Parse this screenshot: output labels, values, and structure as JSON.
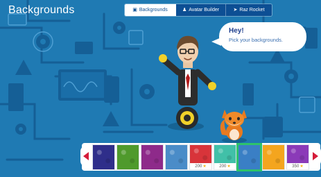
{
  "header": {
    "title": "Backgrounds"
  },
  "tabs": [
    {
      "label": "Backgrounds",
      "icon": "backgrounds-icon",
      "active": true
    },
    {
      "label": "Avatar Builder",
      "icon": "avatar-icon",
      "active": false
    },
    {
      "label": "Raz Rocket",
      "icon": "rocket-icon",
      "active": false
    }
  ],
  "bubble": {
    "title": "Hey!",
    "text": "Pick your backgrounds."
  },
  "swatches": [
    {
      "color": "#2f2e8a",
      "price": ""
    },
    {
      "color": "#4f9a2c",
      "price": ""
    },
    {
      "color": "#8e2a8a",
      "price": ""
    },
    {
      "color": "#4a8cc8",
      "price": ""
    },
    {
      "color": "#d8343a",
      "price": "200"
    },
    {
      "color": "#41c0a8",
      "price": "200"
    },
    {
      "color": "#3a7fc5",
      "price": ""
    },
    {
      "color": "#f4a51e",
      "price": ""
    },
    {
      "color": "#8b3ab8",
      "price": "350"
    }
  ],
  "colors": {
    "scene": "#1f7ab3",
    "tab_bg": "#0d4f94",
    "arrow": "#d51c3a",
    "selected": "#2ec36a"
  }
}
